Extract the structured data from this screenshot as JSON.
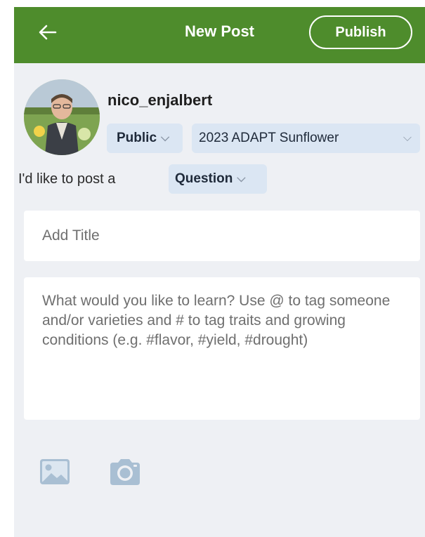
{
  "header": {
    "back_icon": "arrow-left-icon",
    "title": "New Post",
    "publish_label": "Publish"
  },
  "user": {
    "username": "nico_enjalbert",
    "avatar_icon": "avatar-photo"
  },
  "selectors": {
    "visibility": "Public",
    "group": "2023 ADAPT Sunflower"
  },
  "post_type": {
    "prompt": "I'd like to post a",
    "value": "Question"
  },
  "form": {
    "title_placeholder": "Add Title",
    "body_placeholder": "What would you like to learn? Use @ to tag someone and/or varieties and # to tag traits and growing conditions (e.g. #flavor, #yield, #drought)"
  },
  "media": {
    "image_icon": "image-icon",
    "camera_icon": "camera-icon"
  },
  "colors": {
    "header": "#4e8c2c",
    "background": "#eef0f4",
    "chip": "#dbe6f3"
  }
}
